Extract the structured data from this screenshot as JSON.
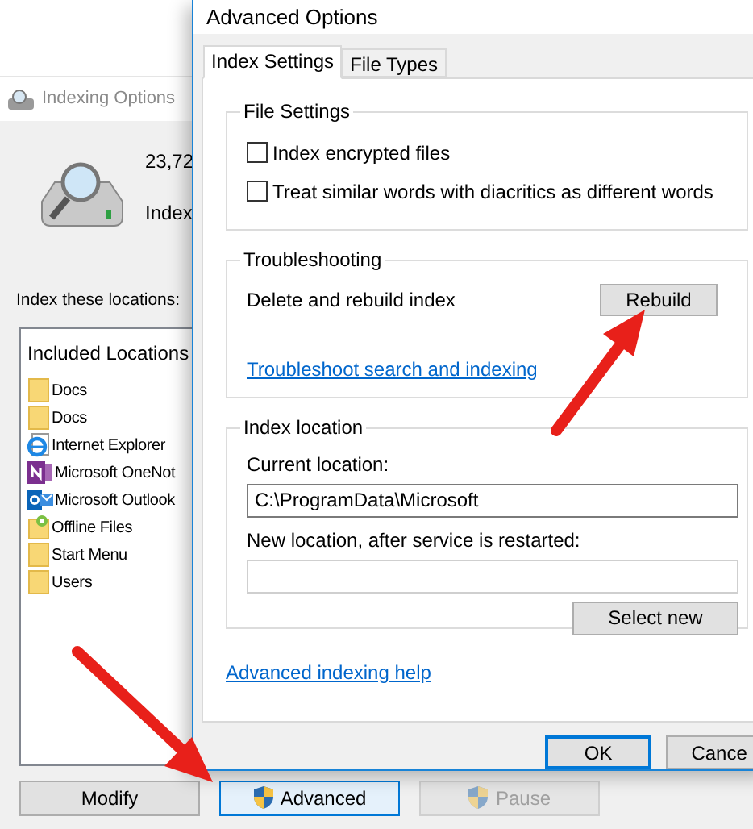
{
  "indexing_window": {
    "title": "Indexing Options",
    "items_count": "23,72",
    "status": "Index",
    "locations_label": "Index these locations:",
    "list_header": "Included Locations",
    "locations": [
      {
        "kind": "folder",
        "name": "Docs"
      },
      {
        "kind": "folder",
        "name": "Docs"
      },
      {
        "kind": "ie",
        "name": "Internet Explorer"
      },
      {
        "kind": "onenote",
        "name": "Microsoft OneNot"
      },
      {
        "kind": "outlook",
        "name": "Microsoft Outlook"
      },
      {
        "kind": "offline",
        "name": "Offline Files"
      },
      {
        "kind": "folder",
        "name": "Start Menu"
      },
      {
        "kind": "folder",
        "name": "Users"
      }
    ],
    "buttons": [
      {
        "label": "Modify",
        "shield": false,
        "focused": false,
        "disabled": false
      },
      {
        "label": "Advanced",
        "shield": true,
        "focused": true,
        "disabled": false
      },
      {
        "label": "Pause",
        "shield": true,
        "focused": false,
        "disabled": true
      }
    ]
  },
  "dialog": {
    "title": "Advanced Options",
    "tabs": [
      {
        "label": "Index Settings",
        "selected": true
      },
      {
        "label": "File Types",
        "selected": false
      }
    ],
    "file_settings": {
      "title": "File Settings",
      "options": [
        {
          "label": "Index encrypted files",
          "checked": false
        },
        {
          "label": "Treat similar words with diacritics as different words",
          "checked": false
        }
      ]
    },
    "troubleshooting": {
      "title": "Troubleshooting",
      "text": "Delete and rebuild index",
      "button": "Rebuild",
      "link": "Troubleshoot search and indexing"
    },
    "index_location": {
      "title": "Index location",
      "current_label": "Current location:",
      "current_value": "C:\\ProgramData\\Microsoft",
      "new_label": "New location, after service is restarted:",
      "button": "Select new"
    },
    "help_link": "Advanced indexing help",
    "buttons": [
      {
        "label": "OK",
        "focused": true
      },
      {
        "label": "Cance",
        "focused": false
      }
    ]
  }
}
